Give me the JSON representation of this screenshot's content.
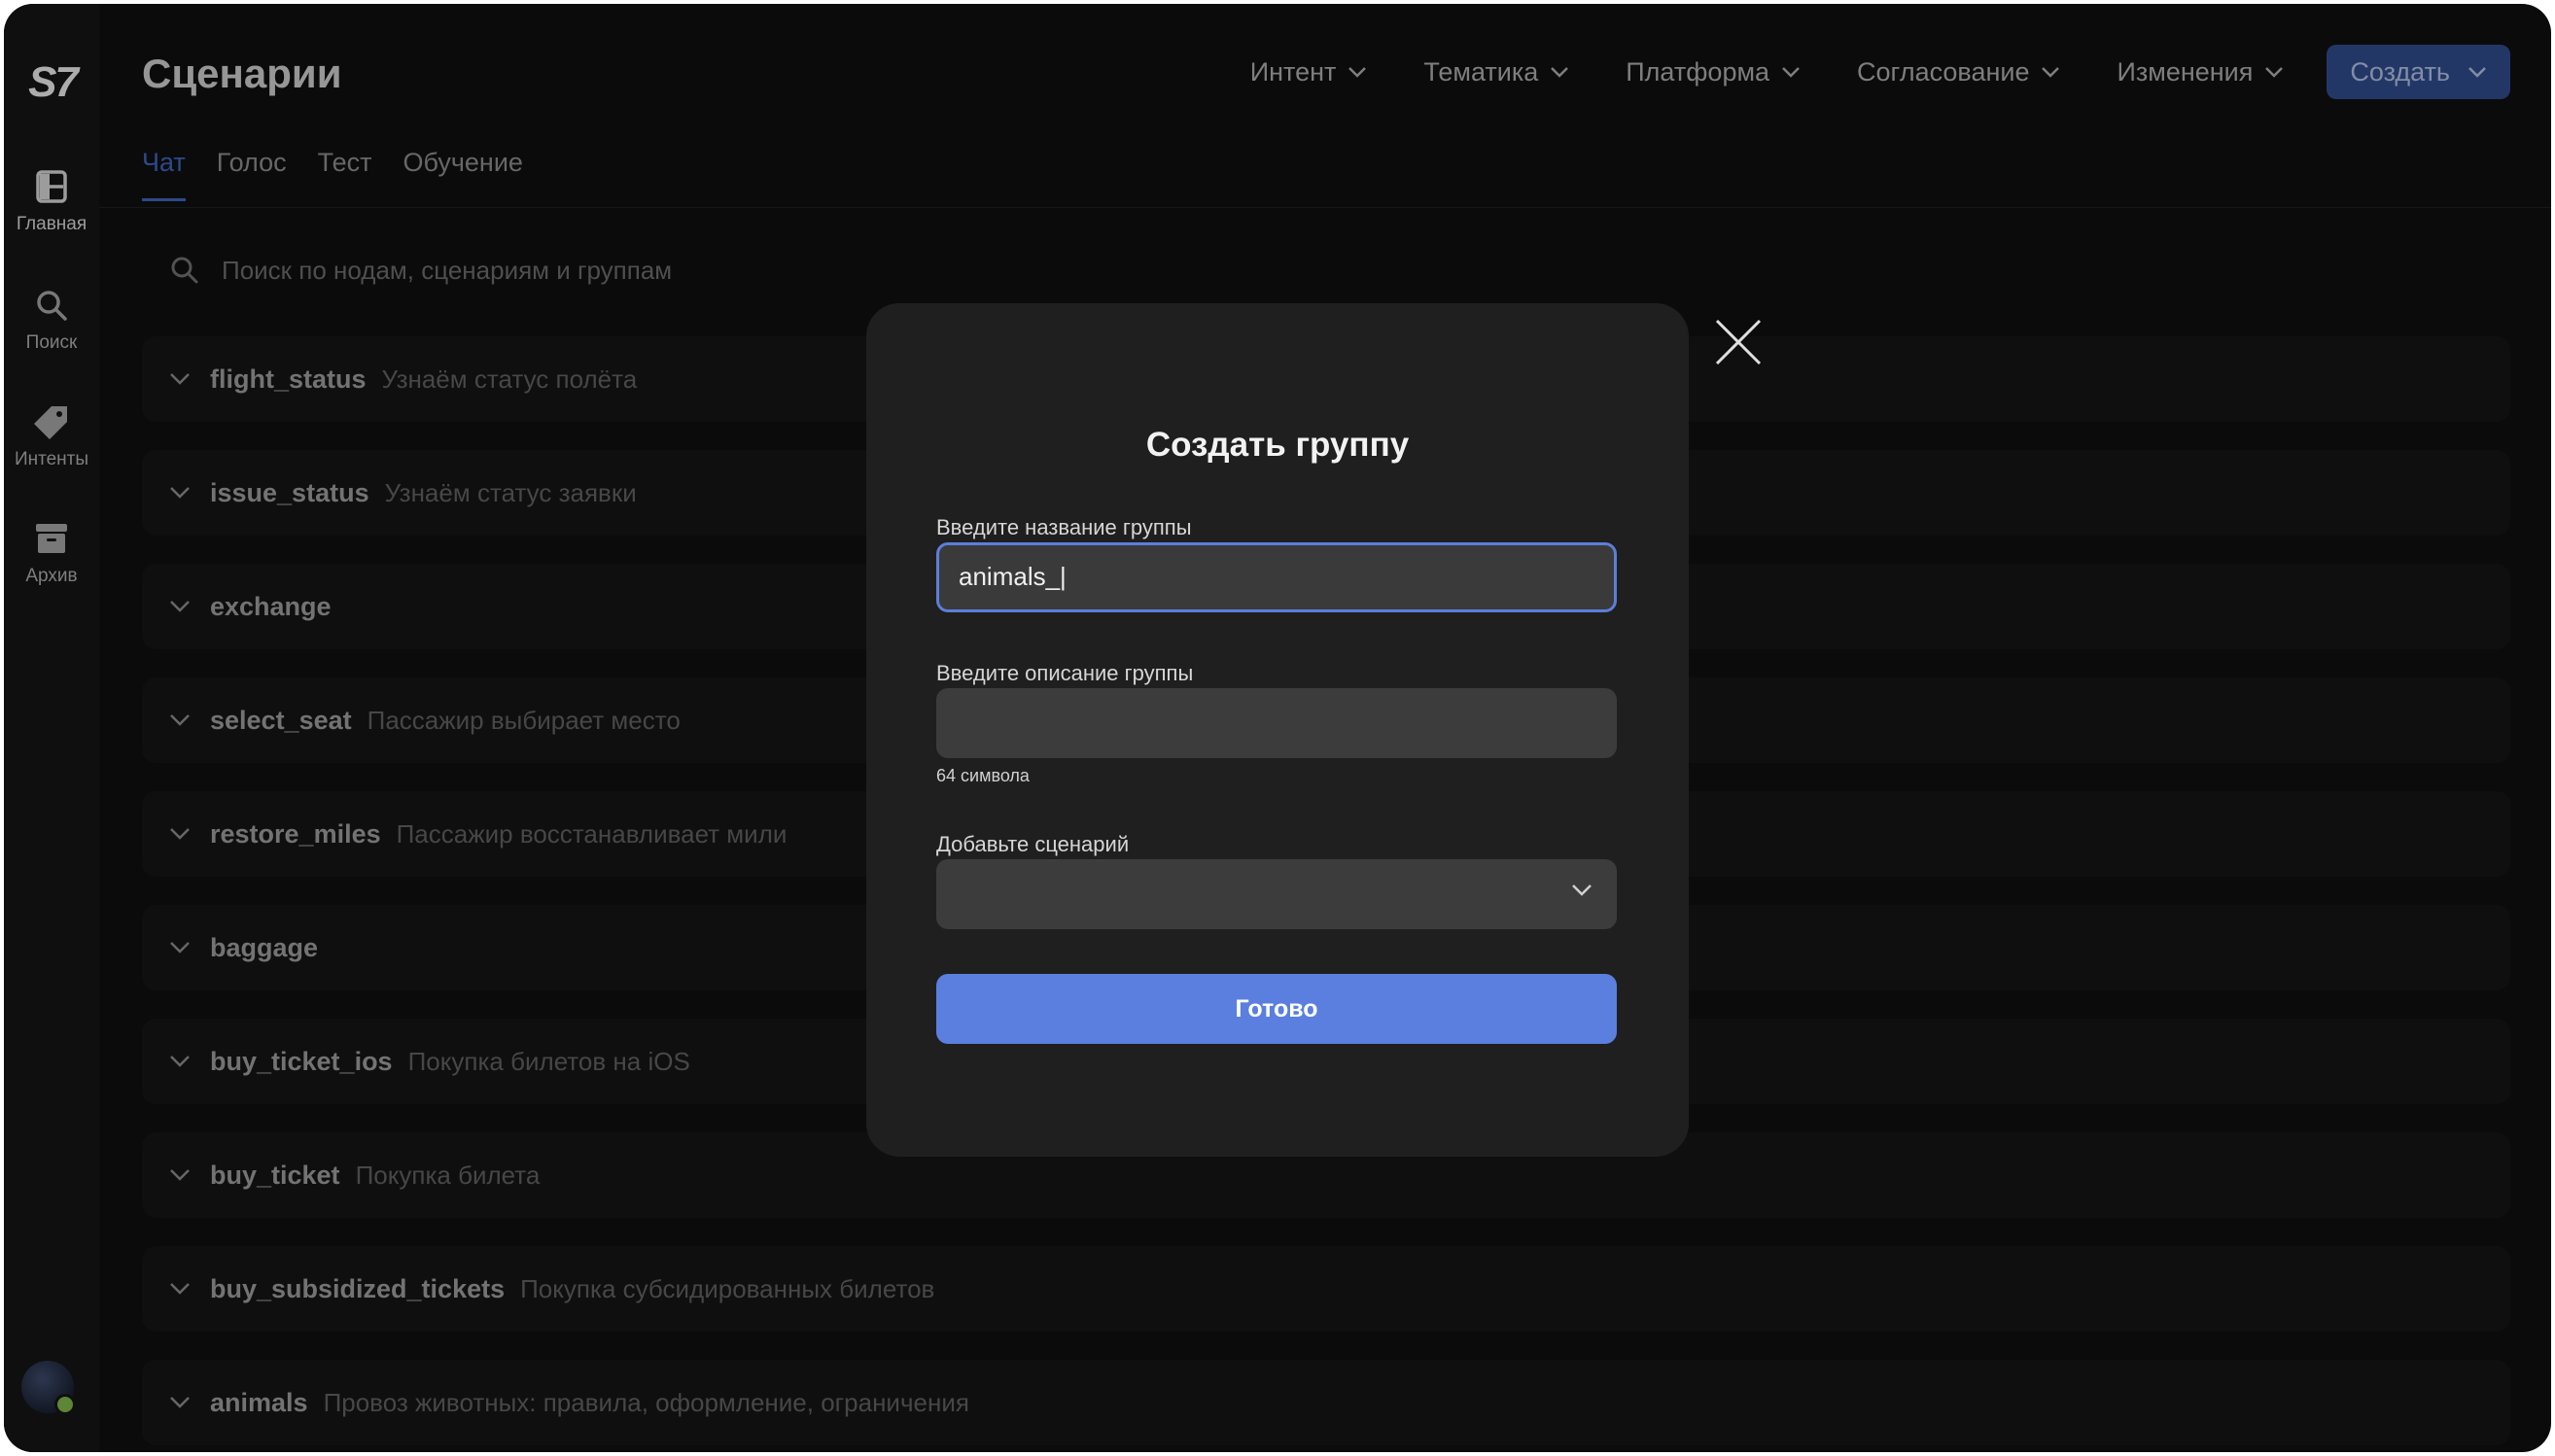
{
  "app": {
    "logo": "S7",
    "page_title": "Сценарии"
  },
  "sidebar": {
    "items": [
      {
        "label": "Главная",
        "icon": "home-icon",
        "active": true
      },
      {
        "label": "Поиск",
        "icon": "search-icon",
        "active": false
      },
      {
        "label": "Интенты",
        "icon": "tag-icon",
        "active": false
      },
      {
        "label": "Архив",
        "icon": "archive-icon",
        "active": false
      }
    ]
  },
  "header": {
    "filters": [
      "Интент",
      "Тематика",
      "Платформа",
      "Согласование",
      "Изменения"
    ],
    "create_label": "Создать"
  },
  "tabs": [
    {
      "label": "Чат",
      "active": true
    },
    {
      "label": "Голос",
      "active": false
    },
    {
      "label": "Тест",
      "active": false
    },
    {
      "label": "Обучение",
      "active": false
    }
  ],
  "search": {
    "placeholder": "Поиск по нодам, сценариям и группам"
  },
  "scenarios": [
    {
      "name": "flight_status",
      "desc": "Узнаём статус полёта"
    },
    {
      "name": "issue_status",
      "desc": "Узнаём статус заявки"
    },
    {
      "name": "exchange",
      "desc": ""
    },
    {
      "name": "select_seat",
      "desc": "Пассажир выбирает место"
    },
    {
      "name": "restore_miles",
      "desc": "Пассажир восстанавливает мили"
    },
    {
      "name": "baggage",
      "desc": ""
    },
    {
      "name": "buy_ticket_ios",
      "desc": "Покупка билетов на iOS"
    },
    {
      "name": "buy_ticket",
      "desc": "Покупка билета"
    },
    {
      "name": "buy_subsidized_tickets",
      "desc": "Покупка субсидированных билетов"
    },
    {
      "name": "animals",
      "desc": "Провоз животных: правила, оформление, ограничения"
    }
  ],
  "modal": {
    "title": "Создать группу",
    "name_label": "Введите название группы",
    "name_value": "animals_|",
    "desc_label": "Введите описание группы",
    "desc_value": "",
    "desc_hint": "64 символа",
    "scenario_label": "Добавьте сценарий",
    "scenario_value": "",
    "done_label": "Готово"
  },
  "colors": {
    "accent": "#5a7fde",
    "tab_active": "#3c62b8",
    "background": "#0f0f10",
    "modal": "#1f1f20"
  }
}
